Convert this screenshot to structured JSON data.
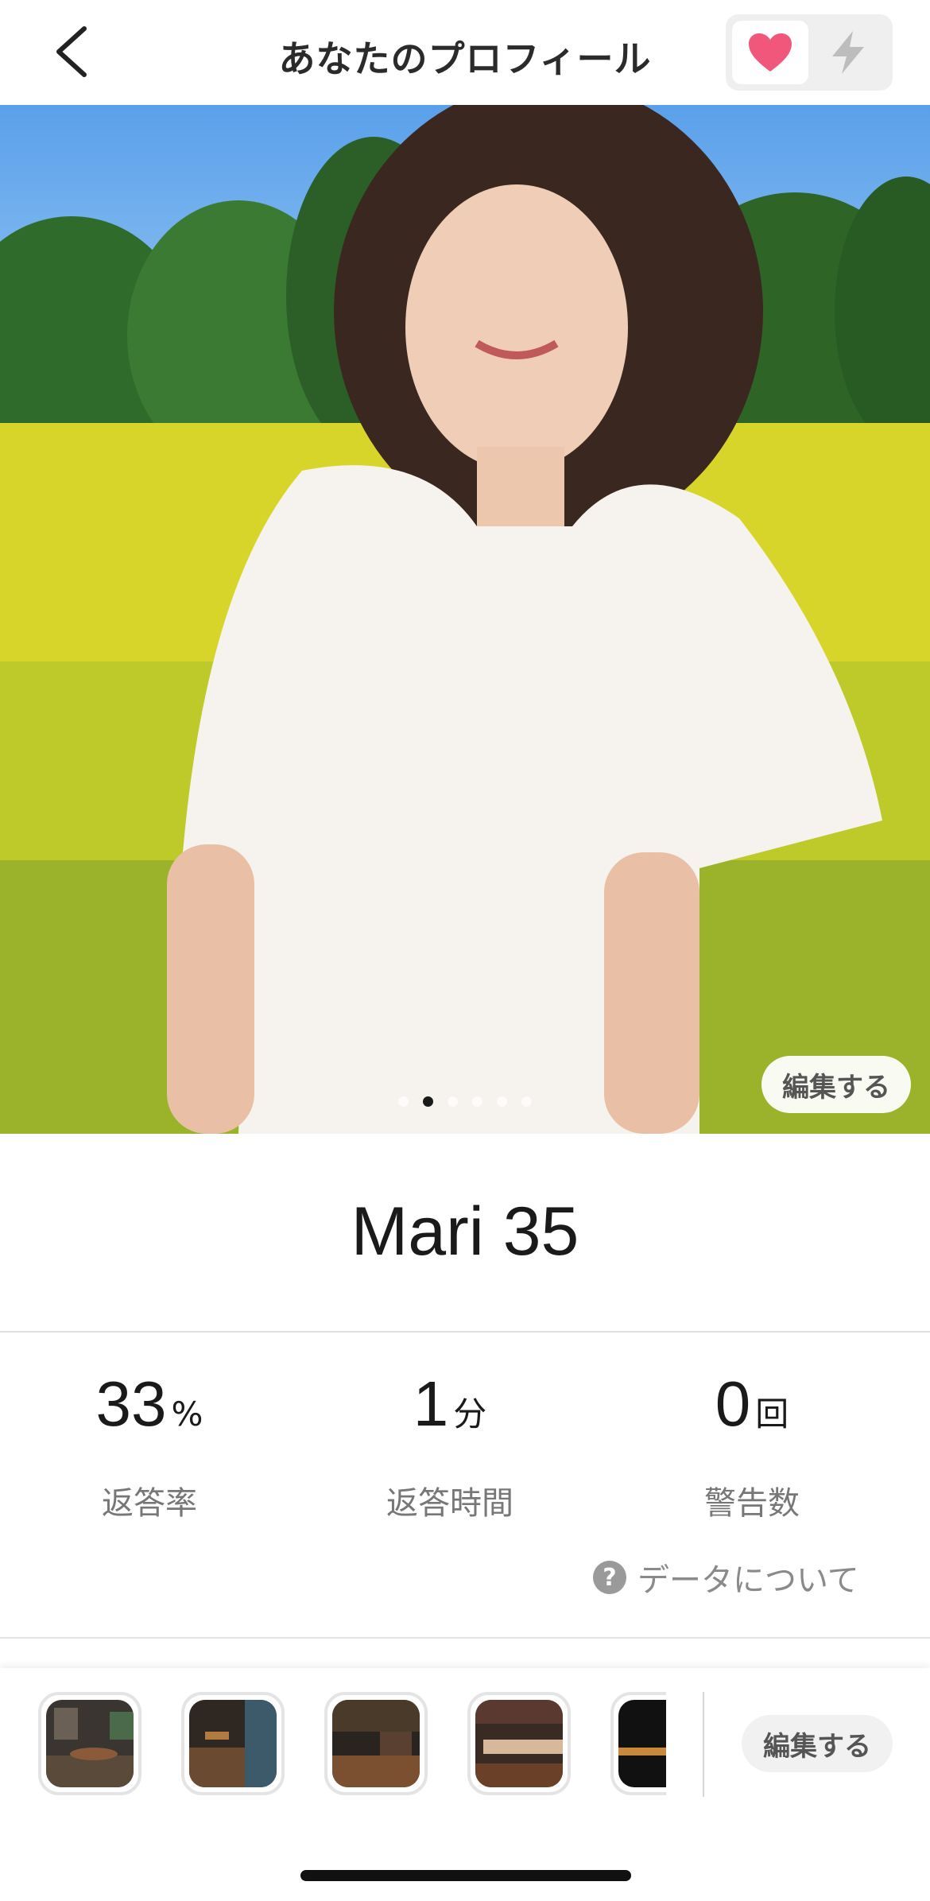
{
  "header": {
    "title": "あなたのプロフィール",
    "back_icon": "chevron-left-icon",
    "modes": [
      {
        "icon": "heart-icon",
        "selected": true,
        "color": "#f0577a"
      },
      {
        "icon": "bolt-icon",
        "selected": false,
        "color": "#bdbdbd"
      }
    ]
  },
  "photo": {
    "edit_label": "編集する",
    "page_count": 6,
    "current_page": 2
  },
  "profile": {
    "name_age": "Mari 35"
  },
  "stats": [
    {
      "value": "33",
      "unit": "%",
      "label": "返答率"
    },
    {
      "value": "1",
      "unit": "分",
      "label": "返答時間"
    },
    {
      "value": "0",
      "unit": "回",
      "label": "警告数"
    }
  ],
  "data_about": {
    "label": "データについて",
    "icon": "question-icon"
  },
  "venues": {
    "edit_label": "編集する",
    "thumbnail_count": 5
  },
  "colors": {
    "accent": "#f0577a",
    "text_primary": "#1a1a1a",
    "text_secondary": "#777777"
  }
}
